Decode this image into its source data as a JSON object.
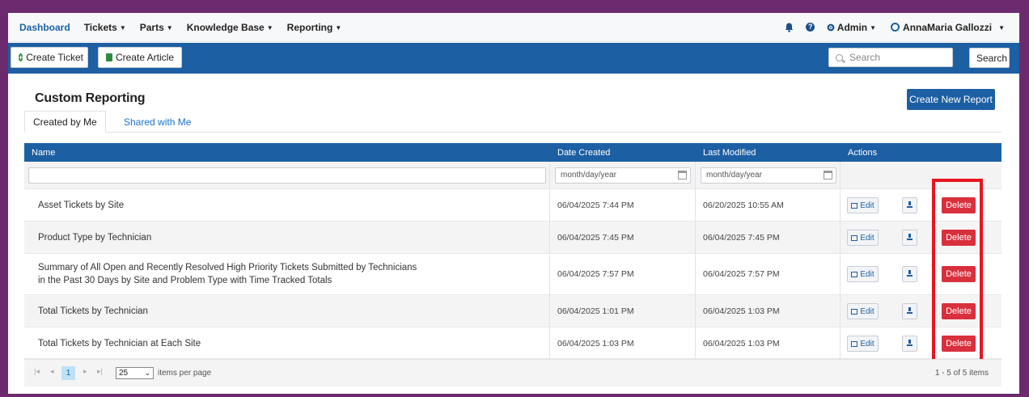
{
  "nav": {
    "items": [
      "Dashboard",
      "Tickets",
      "Parts",
      "Knowledge Base",
      "Reporting"
    ],
    "admin": "Admin",
    "user": "AnnaMaria Gallozzi"
  },
  "toolbar": {
    "create_ticket": "Create Ticket",
    "create_article": "Create Article",
    "search_placeholder": "Search",
    "search_button": "Search"
  },
  "page": {
    "title": "Custom Reporting",
    "create_report": "Create New Report",
    "tabs": [
      "Created by Me",
      "Shared with Me"
    ]
  },
  "table": {
    "headers": [
      "Name",
      "Date Created",
      "Last Modified",
      "Actions"
    ],
    "date_placeholder": "month/day/year",
    "edit_label": "Edit",
    "delete_label": "Delete",
    "rows": [
      {
        "name": "Asset Tickets by Site",
        "name2": "",
        "created": "06/04/2025 7:44 PM",
        "modified": "06/20/2025 10:55 AM"
      },
      {
        "name": "Product Type by Technician",
        "name2": "",
        "created": "06/04/2025 7:45 PM",
        "modified": "06/04/2025 7:45 PM"
      },
      {
        "name": "Summary of All Open and Recently Resolved High Priority Tickets Submitted by Technicians",
        "name2": "in the Past 30 Days by Site and Problem Type with Time Tracked Totals",
        "created": "06/04/2025 7:57 PM",
        "modified": "06/04/2025 7:57 PM"
      },
      {
        "name": "Total Tickets by Technician",
        "name2": "",
        "created": "06/04/2025 1:01 PM",
        "modified": "06/04/2025 1:03 PM"
      },
      {
        "name": "Total Tickets by Technician at Each Site",
        "name2": "",
        "created": "06/04/2025 1:03 PM",
        "modified": "06/04/2025 1:03 PM"
      }
    ]
  },
  "pager": {
    "current_page": "1",
    "page_size": "25",
    "items_per_page": "items per page",
    "summary": "1 - 5 of 5 items"
  }
}
